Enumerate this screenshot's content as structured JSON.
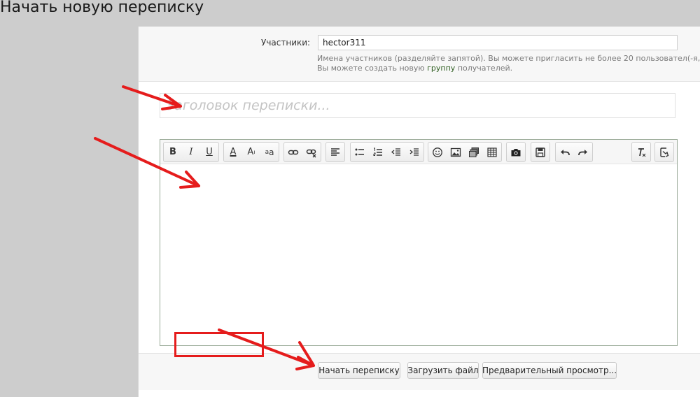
{
  "page": {
    "title": "Начать новую переписку"
  },
  "participants": {
    "label": "Участники:",
    "value": "hector311",
    "hint_line1": "Имена участников (разделяйте запятой). Вы можете пригласить не более 20 пользовател(-я,-ей).",
    "hint_line2_before": "Вы можете создать новую",
    "hint_line2_link": "группу",
    "hint_line2_after": "получателей."
  },
  "title_field": {
    "placeholder": "Заголовок переписки..."
  },
  "toolbar": {
    "bold": "B",
    "italic": "I",
    "underline": "U",
    "font_color": "A",
    "font_size": "A",
    "font_size_sup": "ı",
    "font_family": "a",
    "icons": [
      "bold-icon",
      "italic-icon",
      "underline-icon",
      "font-color-icon",
      "font-size-icon",
      "font-family-icon",
      "link-icon",
      "unlink-icon",
      "align-left-icon",
      "bullet-list-icon",
      "numbered-list-icon",
      "outdent-icon",
      "indent-icon",
      "smiley-icon",
      "image-icon",
      "media-icon",
      "table-icon",
      "camera-icon",
      "save-draft-icon",
      "undo-icon",
      "redo-icon",
      "remove-format-icon",
      "toggle-bbcode-icon"
    ]
  },
  "footer": {
    "start_label": "Начать переписку",
    "upload_label": "Загрузить файл",
    "preview_label": "Предварительный просмотр..."
  },
  "colors": {
    "annotation": "#e51c1c",
    "link": "#2d5d1f",
    "editor_border": "#9aaa98"
  }
}
